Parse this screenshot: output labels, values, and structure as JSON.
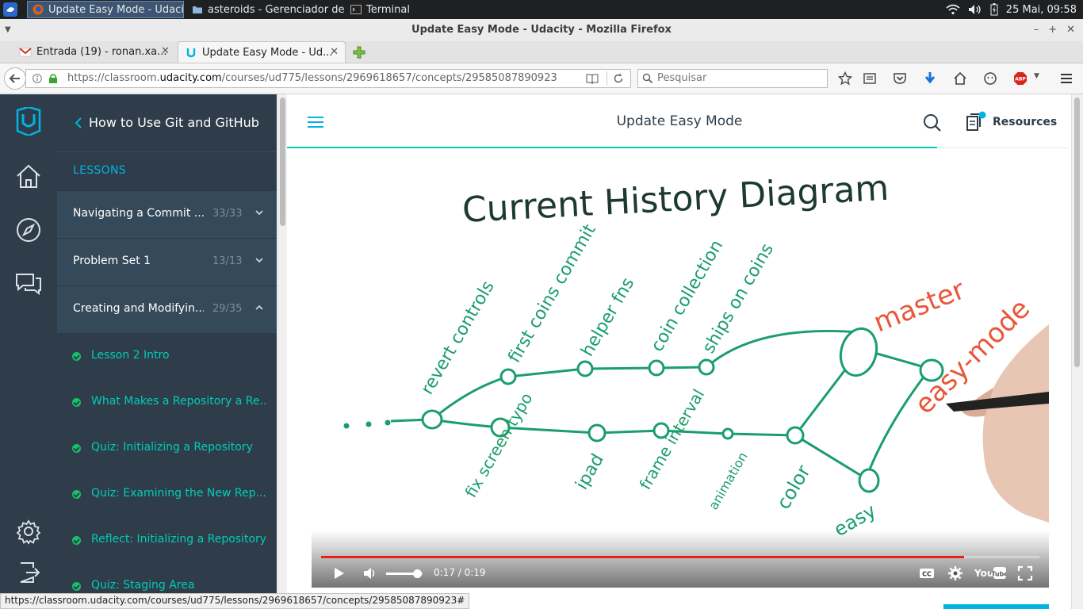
{
  "taskbar": {
    "tasks": [
      {
        "label": "Update Easy Mode - Udaci...",
        "icon": "firefox-icon",
        "active": true
      },
      {
        "label": "asteroids - Gerenciador de ...",
        "icon": "folder-icon",
        "active": false
      },
      {
        "label": "Terminal",
        "icon": "terminal-icon",
        "active": false
      }
    ],
    "clock": "25 Mai, 09:58"
  },
  "browser": {
    "window_title": "Update Easy Mode - Udacity - Mozilla Firefox",
    "tabs": [
      {
        "label": "Entrada (19) - ronan.xa...",
        "icon": "gmail-icon"
      },
      {
        "label": "Update Easy Mode - Ud...",
        "icon": "udacity-icon"
      }
    ],
    "url_prefix": "https://classroom.",
    "url_domain": "udacity.com",
    "url_suffix": "/courses/ud775/lessons/2969618657/concepts/29585087890923",
    "search_placeholder": "Pesquisar",
    "status_url": "https://classroom.udacity.com/courses/ud775/lessons/2969618657/concepts/29585087890923#"
  },
  "sidebar": {
    "course_title": "How to Use Git and GitHub",
    "lessons_heading": "LESSONS",
    "lessons": [
      {
        "name": "Navigating a Commit ...",
        "count": "33/33",
        "expanded": false
      },
      {
        "name": "Problem Set 1",
        "count": "13/13",
        "expanded": false
      },
      {
        "name": "Creating and Modifyin...",
        "count": "29/35",
        "expanded": true
      }
    ],
    "concepts": [
      {
        "name": "Lesson 2 Intro"
      },
      {
        "name": "What Makes a Repository a Re..."
      },
      {
        "name": "Quiz: Initializing a Repository"
      },
      {
        "name": "Quiz: Examining the New Rep..."
      },
      {
        "name": "Reflect: Initializing a Repository"
      },
      {
        "name": "Quiz: Staging Area"
      }
    ]
  },
  "main": {
    "title": "Update Easy Mode",
    "resources_label": "Resources"
  },
  "video": {
    "time": "0:17 / 0:19",
    "progress": 0.8947,
    "volume": 0.85,
    "board": {
      "title": "Current History Diagram",
      "top_labels": [
        "revert controls",
        "first coins commit",
        "helper fns",
        "coin collection",
        "ships on coins"
      ],
      "bottom_labels": [
        "fix screen typo",
        "ipad",
        "frame interval",
        "animation",
        "color",
        "easy"
      ],
      "branch_labels": [
        "master",
        "easy-mode"
      ],
      "ellipsis": ". . ."
    }
  },
  "colors": {
    "udacity_dark": "#2e3d49",
    "udacity_teal": "#02ccba",
    "udacity_blue": "#02b3e4",
    "complete_green": "#15c26b",
    "marker_green": "#1a9e6c",
    "marker_dark": "#1d3a2e",
    "marker_orange": "#e8573a",
    "youtube_red": "#e62117"
  }
}
